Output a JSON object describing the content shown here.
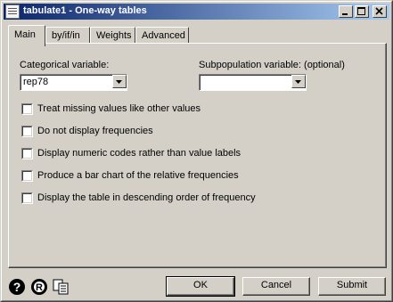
{
  "window": {
    "title": "tabulate1 - One-way tables",
    "buttons": {
      "minimize": "minimize-icon",
      "maximize": "maximize-icon",
      "close": "close-icon"
    }
  },
  "tabs": [
    {
      "label": "Main",
      "active": true
    },
    {
      "label": "by/if/in",
      "active": false
    },
    {
      "label": "Weights",
      "active": false
    },
    {
      "label": "Advanced",
      "active": false
    }
  ],
  "main": {
    "categorical_label": "Categorical variable:",
    "categorical_value": "rep78",
    "subpop_label": "Subpopulation variable: (optional)",
    "subpop_value": "",
    "options": [
      {
        "label": "Treat missing values like other values",
        "checked": false
      },
      {
        "label": "Do not display frequencies",
        "checked": false
      },
      {
        "label": "Display numeric codes rather than value labels",
        "checked": false
      },
      {
        "label": "Produce a bar chart of the relative frequencies",
        "checked": false
      },
      {
        "label": "Display the table in descending order of frequency",
        "checked": false
      }
    ]
  },
  "footer": {
    "icons": [
      "help-icon",
      "reset-icon",
      "copy-icon"
    ],
    "ok_label": "OK",
    "cancel_label": "Cancel",
    "submit_label": "Submit"
  },
  "colors": {
    "titlebar_start": "#0a246a",
    "titlebar_end": "#a6caf0",
    "face": "#d4d0c8"
  }
}
